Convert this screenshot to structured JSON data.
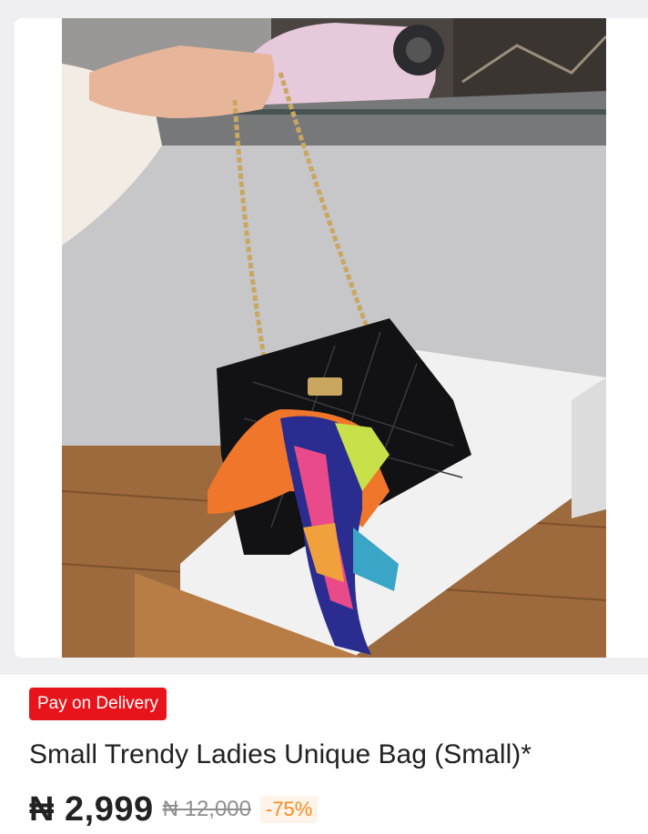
{
  "product": {
    "image_alt": "Black quilted handbag with gold chain strap and colorful scarf",
    "badge": "Pay on Delivery",
    "title": "Small Trendy Ladies Unique Bag (Small)*",
    "price": "₦ 2,999",
    "old_price": "₦ 12,000",
    "discount": "-75%"
  },
  "colors": {
    "badge_bg": "#e8141c",
    "discount_text": "#f68b1e",
    "discount_bg": "#fef3e9"
  }
}
